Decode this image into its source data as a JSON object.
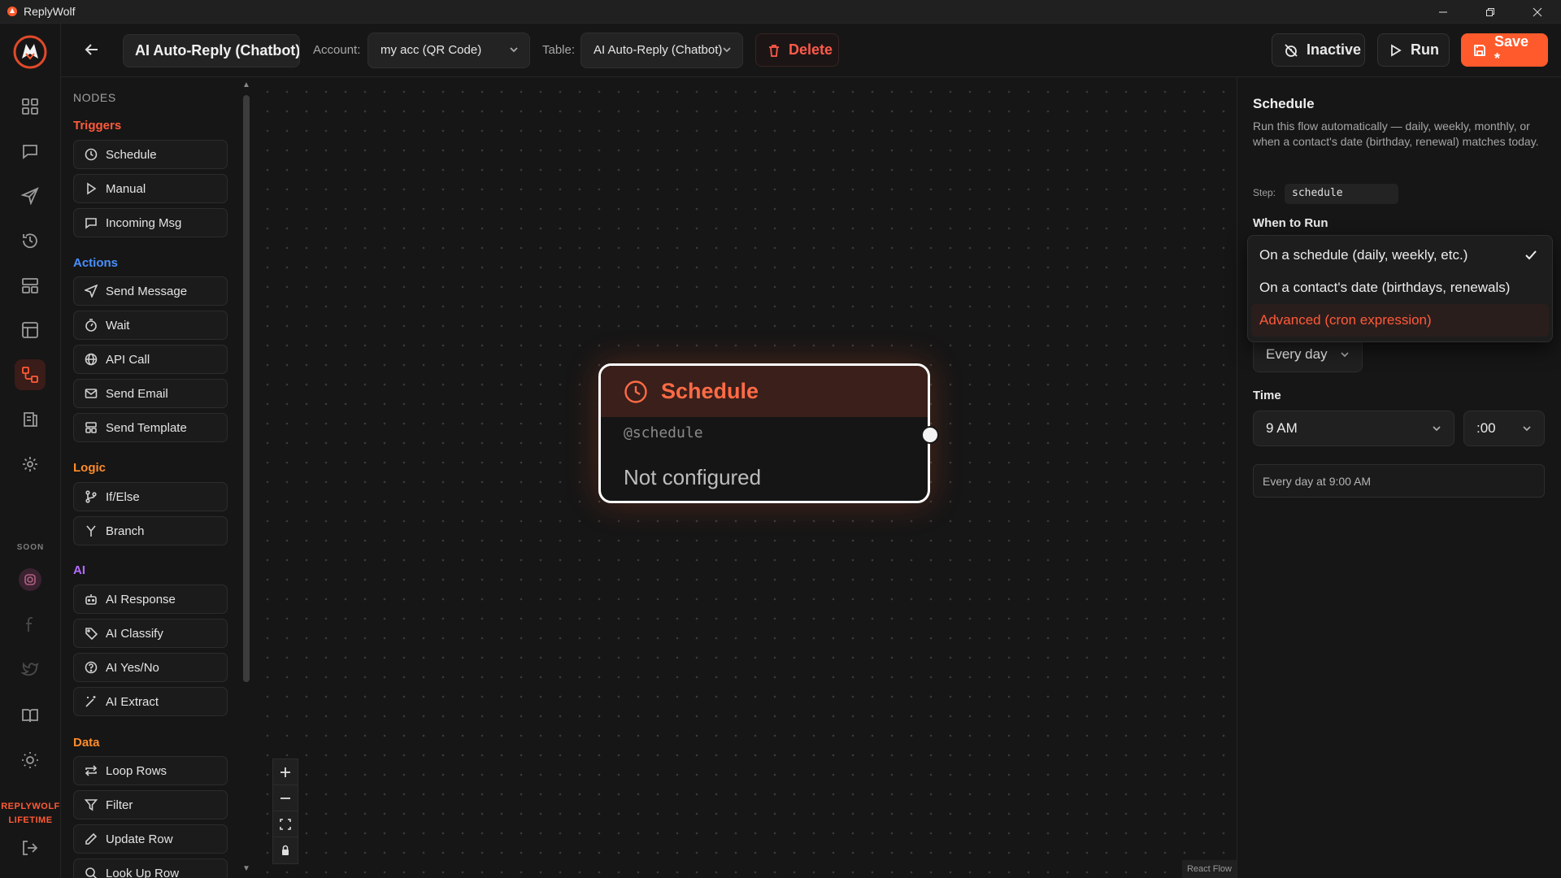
{
  "window": {
    "title": "ReplyWolf"
  },
  "rail": {
    "soon_label": "SOON",
    "brand_line1": "REPLYWOLF",
    "brand_line2": "LIFETIME"
  },
  "toolbar": {
    "flow_name": "AI Auto-Reply (Chatbot)",
    "account_label": "Account:",
    "account_value": "my acc (QR Code)",
    "table_label": "Table:",
    "table_value": "AI Auto-Reply (Chatbot)",
    "delete_label": "Delete",
    "inactive_label": "Inactive",
    "run_label": "Run",
    "save_label": "Save *"
  },
  "palette": {
    "title": "NODES",
    "categories": [
      {
        "name": "Triggers",
        "color": "#ff5a3a",
        "items": [
          "Schedule",
          "Manual",
          "Incoming Msg"
        ]
      },
      {
        "name": "Actions",
        "color": "#4a90ff",
        "items": [
          "Send Message",
          "Wait",
          "API Call",
          "Send Email",
          "Send Template"
        ]
      },
      {
        "name": "Logic",
        "color": "#ff8c2a",
        "items": [
          "If/Else",
          "Branch"
        ]
      },
      {
        "name": "AI",
        "color": "#b56cff",
        "items": [
          "AI Response",
          "AI Classify",
          "AI Yes/No",
          "AI Extract"
        ]
      },
      {
        "name": "Data",
        "color": "#ff8c2a",
        "items": [
          "Loop Rows",
          "Filter",
          "Update Row",
          "Look Up Row"
        ]
      }
    ]
  },
  "canvas": {
    "node": {
      "title": "Schedule",
      "id": "@schedule",
      "status": "Not configured"
    },
    "attribution": "React Flow"
  },
  "panel": {
    "title": "Schedule",
    "description": "Run this flow automatically — daily, weekly, monthly, or when a contact's date (birthday, renewal) matches today.",
    "step_label": "Step:",
    "step_value": "schedule",
    "when_label": "When to Run",
    "when_options": [
      "On a schedule (daily, weekly, etc.)",
      "On a contact's date (birthdays, renewals)",
      "Advanced (cron expression)"
    ],
    "frequency_value": "Every day",
    "time_label": "Time",
    "hour_value": "9 AM",
    "minute_value": ":00",
    "summary": "Every day at 9:00 AM"
  },
  "colors": {
    "accent": "#ff5a2c",
    "danger": "#ff5a4a"
  }
}
